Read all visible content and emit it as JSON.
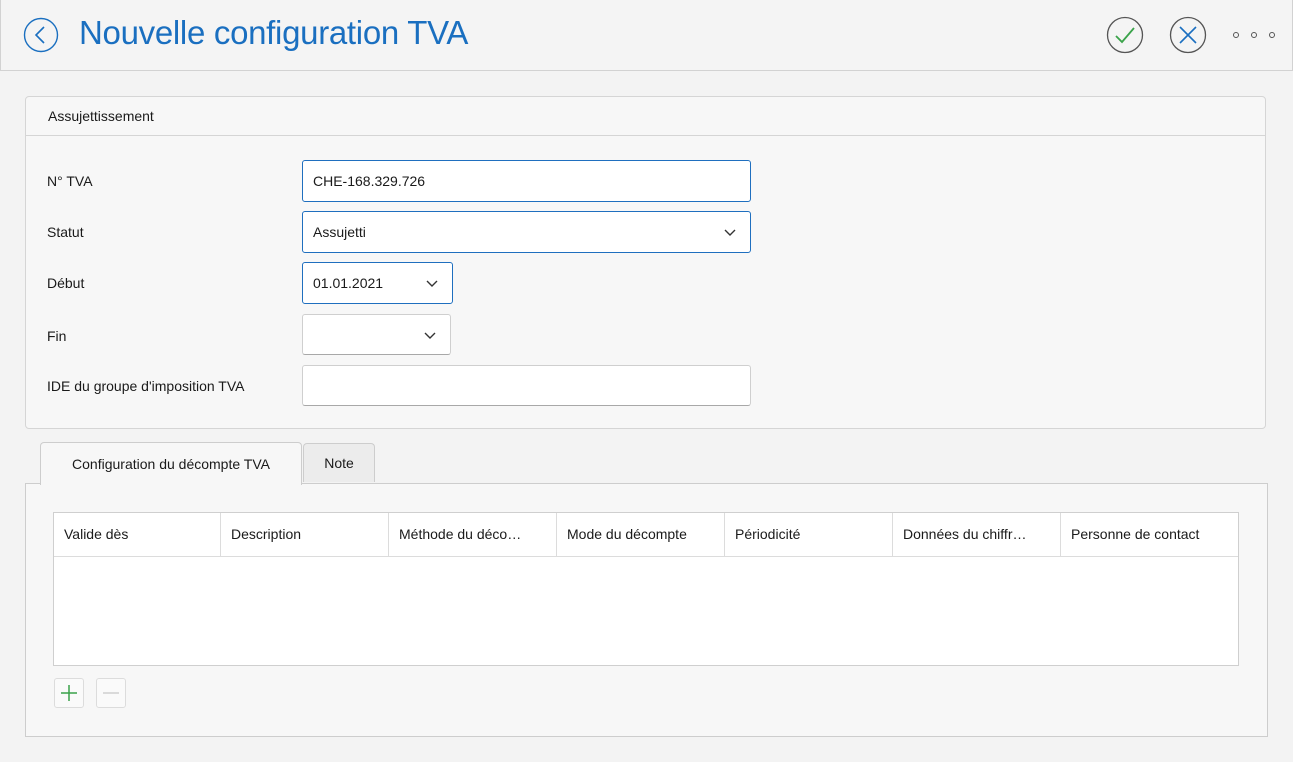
{
  "header": {
    "title": "Nouvelle configuration TVA"
  },
  "section": {
    "title": "Assujettissement",
    "fields": {
      "vat_number": {
        "label": "N° TVA",
        "value": "CHE-168.329.726"
      },
      "status": {
        "label": "Statut",
        "value": "Assujetti"
      },
      "start": {
        "label": "Début",
        "value": "01.01.2021"
      },
      "end": {
        "label": "Fin",
        "value": ""
      },
      "group_ide": {
        "label": "IDE du groupe d'imposition TVA",
        "value": ""
      }
    }
  },
  "tabs": [
    {
      "label": "Configuration du décompte TVA",
      "active": true
    },
    {
      "label": "Note",
      "active": false
    }
  ],
  "table": {
    "columns": [
      "Valide dès",
      "Description",
      "Méthode du déco…",
      "Mode du décompte",
      "Périodicité",
      "Données du chiffr…",
      "Personne de contact"
    ],
    "rows": []
  },
  "colors": {
    "accent": "#1a6fc0",
    "confirm": "#3aa34a",
    "add": "#3aa34a"
  }
}
